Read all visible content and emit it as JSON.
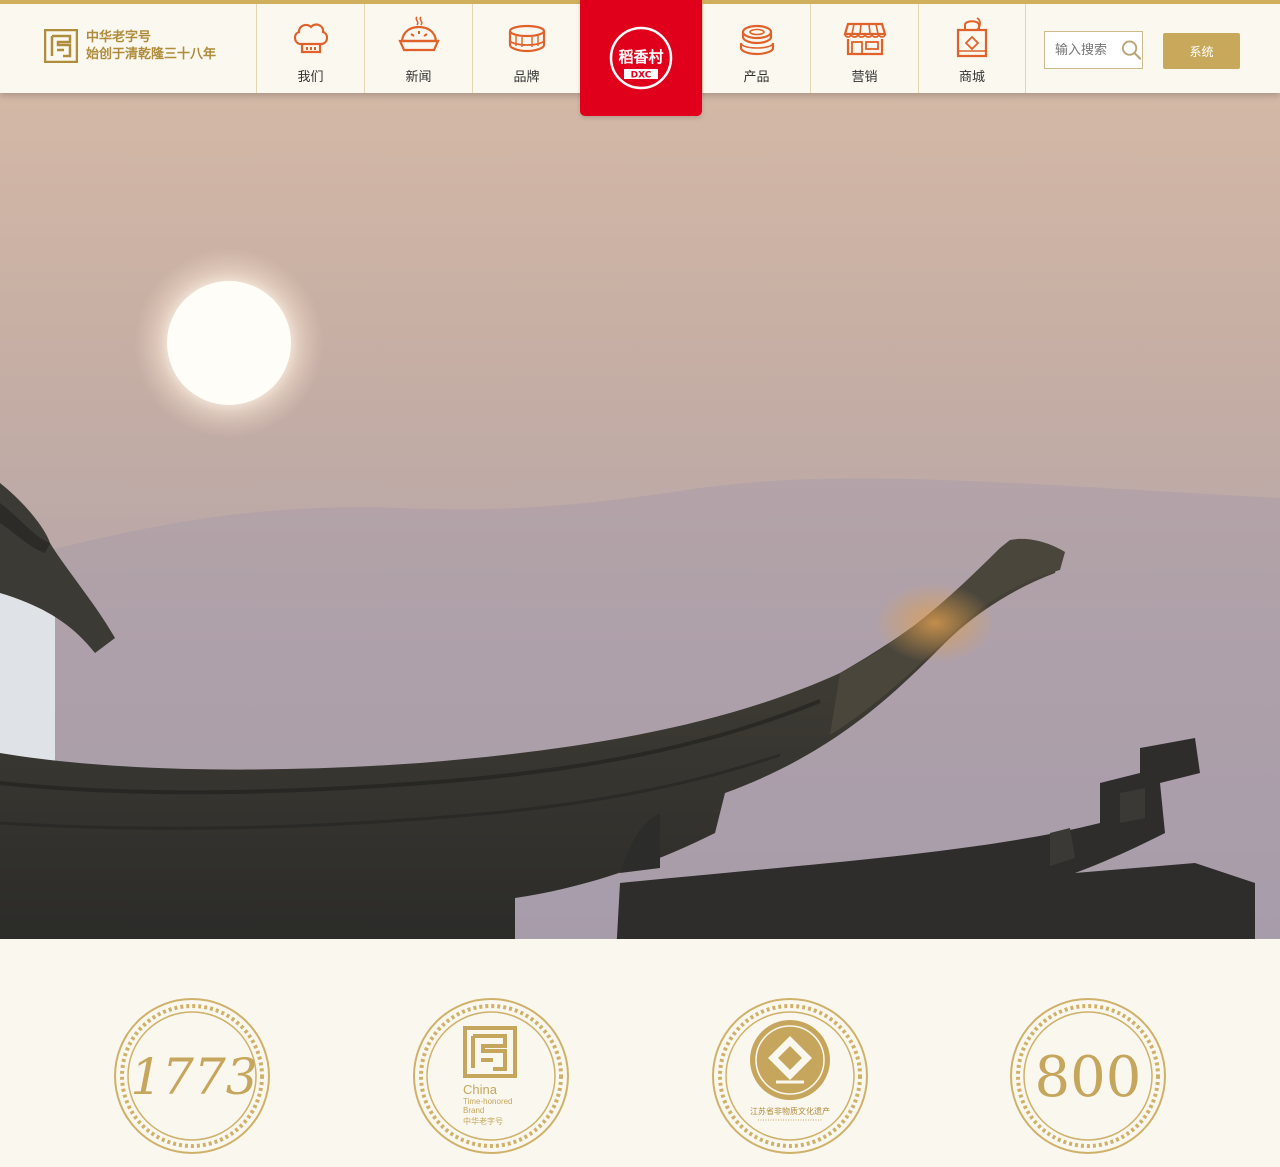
{
  "header": {
    "brand": {
      "line1": "中华老字号",
      "line2": "始创于清乾隆三十八年"
    },
    "nav": [
      {
        "label": "我们",
        "icon": "chef-hat-icon"
      },
      {
        "label": "新闻",
        "icon": "pie-icon"
      },
      {
        "label": "品牌",
        "icon": "cake-icon"
      },
      {
        "label": "产品",
        "icon": "pastry-icon"
      },
      {
        "label": "营销",
        "icon": "store-icon"
      },
      {
        "label": "商城",
        "icon": "shopping-bag-icon"
      }
    ],
    "logo": {
      "text_top": "稻香村",
      "text_bottom": "DXC"
    },
    "search": {
      "placeholder": "输入搜索"
    },
    "system_button": "系统"
  },
  "hero": {
    "scene": "sunset over traditional upturned roof eaves"
  },
  "badges": [
    {
      "name": "1773",
      "text": "1773"
    },
    {
      "name": "china-time-honored-brand",
      "line1": "China",
      "line2": "Time-honored",
      "line3": "Brand",
      "line4": "中华老字号"
    },
    {
      "name": "jiangsu-heritage",
      "line1": "江苏省非物质文化遗产"
    },
    {
      "name": "800",
      "text": "800"
    }
  ],
  "colors": {
    "gold": "#c8a95c",
    "red": "#e0001b",
    "icon_orange": "#e0622a"
  }
}
